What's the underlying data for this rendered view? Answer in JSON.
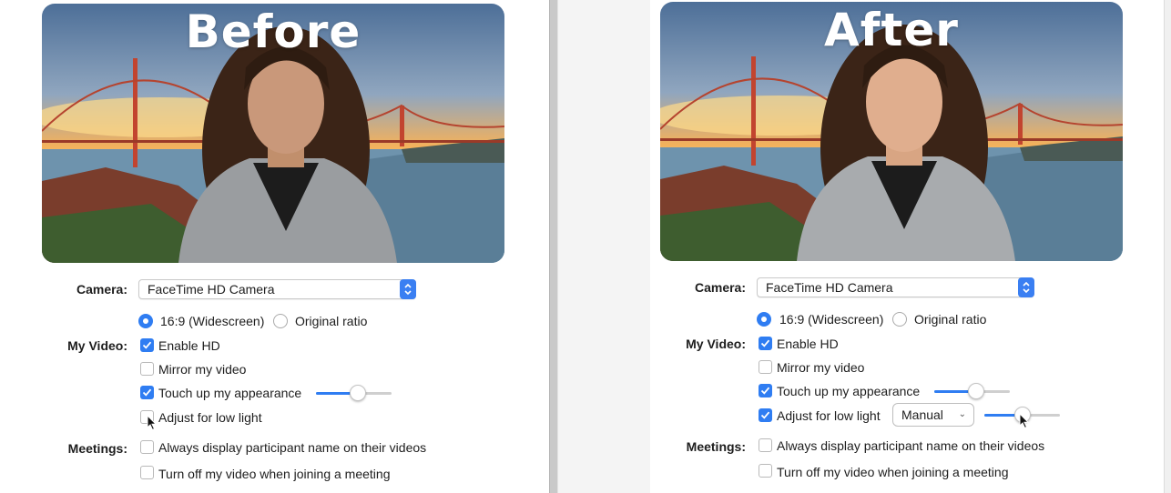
{
  "panels": [
    {
      "title": "Before",
      "camera_label": "Camera:",
      "camera_value": "FaceTime HD Camera",
      "aspect_options": [
        {
          "label": "16:9 (Widescreen)",
          "selected": true
        },
        {
          "label": "Original ratio",
          "selected": false
        }
      ],
      "my_video_label": "My Video:",
      "video_options": [
        {
          "label": "Enable HD",
          "checked": true
        },
        {
          "label": "Mirror my video",
          "checked": false
        },
        {
          "label": "Touch up my appearance",
          "checked": true,
          "level": 0.55
        },
        {
          "label": "Adjust for low light",
          "checked": false
        }
      ],
      "meetings_label": "Meetings:",
      "meeting_options": [
        {
          "label": "Always display participant name on their videos",
          "checked": false
        },
        {
          "label": "Turn off my video when joining a meeting",
          "checked": false
        }
      ]
    },
    {
      "title": "After",
      "camera_label": "Camera:",
      "camera_value": "FaceTime HD Camera",
      "aspect_options": [
        {
          "label": "16:9 (Widescreen)",
          "selected": true
        },
        {
          "label": "Original ratio",
          "selected": false
        }
      ],
      "my_video_label": "My Video:",
      "video_options": [
        {
          "label": "Enable HD",
          "checked": true
        },
        {
          "label": "Mirror my video",
          "checked": false
        },
        {
          "label": "Touch up my appearance",
          "checked": true,
          "level": 0.55
        },
        {
          "label": "Adjust for low light",
          "checked": true,
          "mode": "Manual",
          "level": 0.5
        }
      ],
      "meetings_label": "Meetings:",
      "meeting_options": [
        {
          "label": "Always display participant name on their videos",
          "checked": false
        },
        {
          "label": "Turn off my video when joining a meeting",
          "checked": false
        }
      ]
    }
  ],
  "colors": {
    "accent": "#2f7df2",
    "stepper": "#3a7ff2",
    "track": "#cfcfcf"
  },
  "icons": {
    "stepper": "up-down-chevron-icon",
    "check": "checkmark-icon",
    "cursor": "mouse-pointer-icon",
    "dropdown": "chevron-down-icon"
  }
}
